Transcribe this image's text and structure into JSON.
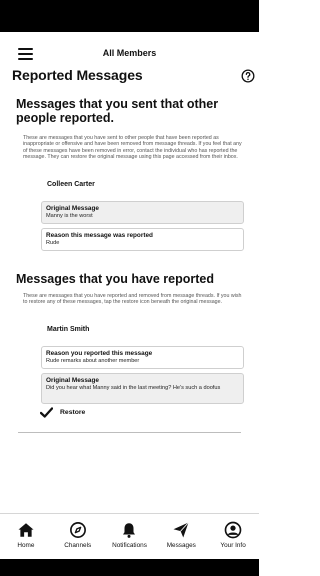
{
  "header": {
    "title": "All Members",
    "menu_icon": "hamburger-icon"
  },
  "page": {
    "title": "Reported Messages",
    "help_icon": "question-circle-icon"
  },
  "sent_section": {
    "heading": "Messages that you sent that other people reported.",
    "description": "These are messages that you have sent to other people that have been reported as inappropriate or offensive and have been removed from message threads. If you feel that any of these messages have been removed in error, contact the individual who has reported the message. They can restore the original message using this page accessed from their inbox.",
    "reports": [
      {
        "person": "Colleen Carter",
        "original_title": "Original Message",
        "original_text": "Manny is the worst",
        "reason_title": "Reason this message was reported",
        "reason_text": "Rude"
      }
    ]
  },
  "reported_section": {
    "heading": "Messages that you have reported",
    "description": "These are messages that you have reported and removed from message threads. If you wish to restore any of these messages, tap the restore icon beneath the original message.",
    "reports": [
      {
        "person": "Martin Smith",
        "reason_title": "Reason you reported this message",
        "reason_text": "Rude remarks about another member",
        "original_title": "Original Message",
        "original_text": "Did you hear what Manny said in the last meeting? He's such a doofus",
        "restore_label": "Restore",
        "restore_icon": "checkmark-icon"
      }
    ]
  },
  "bottom_nav": [
    {
      "label": "Home",
      "icon": "home-icon"
    },
    {
      "label": "Channels",
      "icon": "compass-icon"
    },
    {
      "label": "Notifications",
      "icon": "bell-icon"
    },
    {
      "label": "Messages",
      "icon": "paper-plane-icon"
    },
    {
      "label": "Your Info",
      "icon": "user-circle-icon"
    }
  ]
}
